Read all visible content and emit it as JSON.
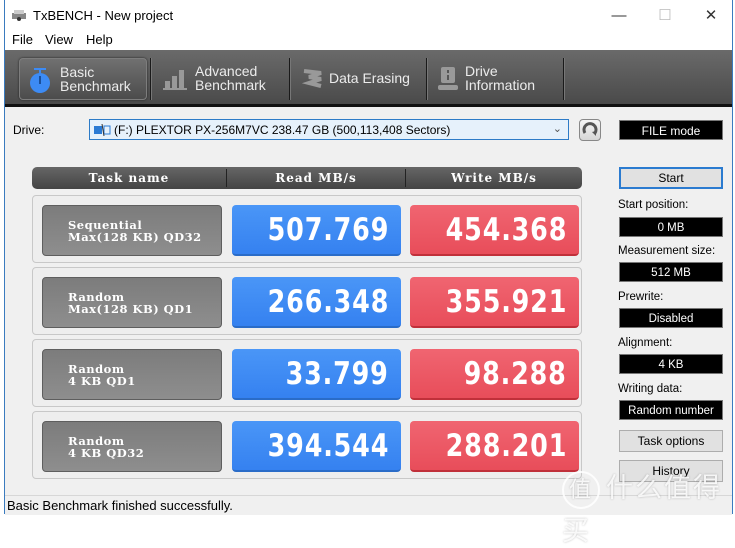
{
  "window": {
    "title": "TxBENCH - New project",
    "controls": {
      "minimize": "—",
      "maximize": "☐",
      "close": "✕"
    }
  },
  "menu": [
    "File",
    "View",
    "Help"
  ],
  "tabs": [
    {
      "label": "Basic\nBenchmark",
      "icon": "stopwatch-icon",
      "active": true
    },
    {
      "label": "Advanced\nBenchmark",
      "icon": "bar-chart-icon",
      "active": false
    },
    {
      "label": "Data Erasing",
      "icon": "eraser-icon",
      "active": false
    },
    {
      "label": "Drive\nInformation",
      "icon": "drive-info-icon",
      "active": false
    }
  ],
  "drive": {
    "label": "Drive:",
    "selected": "(F:) PLEXTOR PX-256M7VC  238.47 GB (500,113,408 Sectors)"
  },
  "mode": "FILE mode",
  "grid": {
    "headers": [
      "Task name",
      "Read MB/s",
      "Write MB/s"
    ],
    "rows": [
      {
        "line1": "Sequential",
        "line2": "Max(128 KB) QD32",
        "read": "507.769",
        "write": "454.368"
      },
      {
        "line1": "Random",
        "line2": "Max(128 KB) QD1",
        "read": "266.348",
        "write": "355.921"
      },
      {
        "line1": "Random",
        "line2": "4 KB QD1",
        "read": "33.799",
        "write": "98.288"
      },
      {
        "line1": "Random",
        "line2": "4 KB QD32",
        "read": "394.544",
        "write": "288.201"
      }
    ]
  },
  "side": {
    "start": "Start",
    "start_position_label": "Start position:",
    "start_position": "0 MB",
    "measurement_size_label": "Measurement size:",
    "measurement_size": "512 MB",
    "prewrite_label": "Prewrite:",
    "prewrite": "Disabled",
    "alignment_label": "Alignment:",
    "alignment": "4 KB",
    "writing_data_label": "Writing data:",
    "writing_data": "Random number",
    "task_options": "Task options",
    "history": "History"
  },
  "status": "Basic Benchmark finished successfully.",
  "watermark": {
    "badge": "值",
    "text": "什么值得买"
  },
  "colors": {
    "read": "#3d8bf4",
    "write": "#ec5966",
    "toolbar": "#555555",
    "task": "#858585"
  }
}
